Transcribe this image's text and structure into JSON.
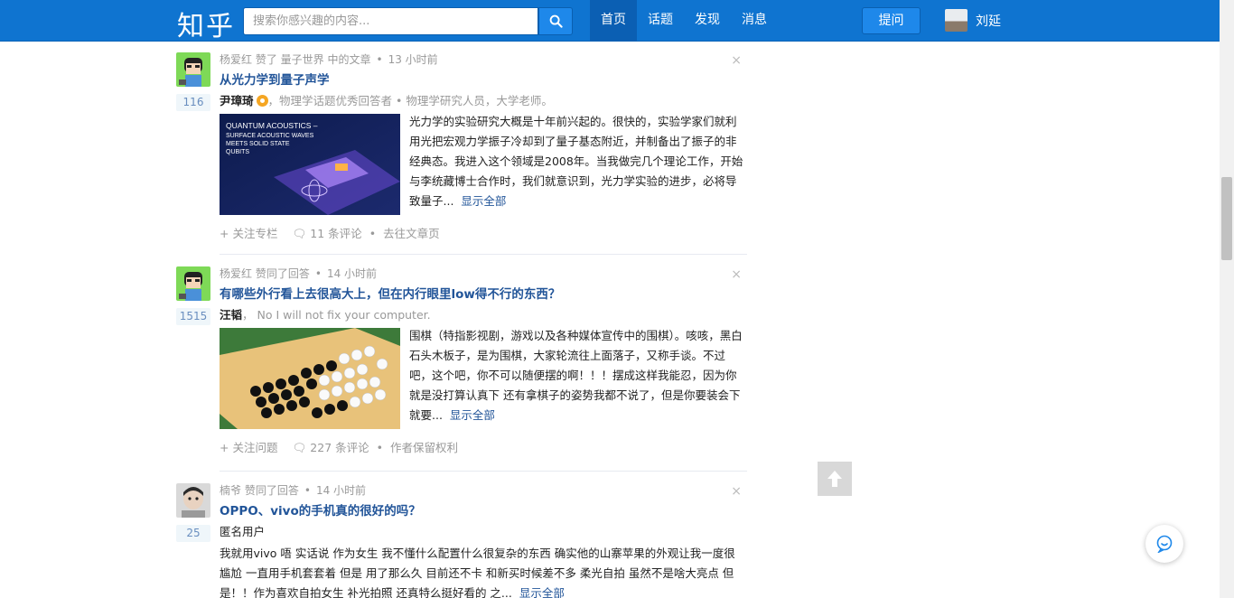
{
  "header": {
    "logo": "知乎",
    "search_placeholder": "搜索你感兴趣的内容...",
    "nav": [
      "首页",
      "话题",
      "发现",
      "消息"
    ],
    "ask_label": "提问",
    "user_name": "刘延"
  },
  "feed": [
    {
      "actor": "杨爱红",
      "action": "赞了 量子世界 中的文章",
      "time": "13 小时前",
      "votes": "116",
      "title": "从光力学到量子声学",
      "author_name": "尹璋琦",
      "author_bio": "，物理学话题优秀回答者 • 物理学研究人员，大学老师。",
      "thumb_text": [
        "QUANTUM ACOUSTICS –",
        "SURFACE ACOUSTIC WAVES",
        "MEETS SOLID STATE",
        "QUBITS"
      ],
      "summary": "光力学的实验研究大概是十年前兴起的。很快的，实验学家们就利用光把宏观力学振子冷却到了量子基态附近，并制备出了振子的非经典态。我进入这个领域是2008年。当我做完几个理论工作，开始与李统藏博士合作时，我们就意识到，光力学实验的进步，必将导致量子...",
      "more": "显示全部",
      "actions": [
        "+ 关注专栏",
        "11 条评论",
        "去往文章页"
      ]
    },
    {
      "actor": "杨爱红",
      "action": "赞同了回答",
      "time": "14 小时前",
      "votes": "1515",
      "title": "有哪些外行看上去很高大上，但在内行眼里low得不行的东西？",
      "author_name": "汪韬",
      "author_bio": "， No I will not fix your computer.",
      "summary": "围棋（特指影视剧，游戏以及各种媒体宣传中的围棋）。咳咳，黑白石头木板子，是为围棋，大家轮流往上面落子，又称手谈。不过吧，这个吧，你不可以随便摆的啊！！！摆成这样我能忍，因为你就是没打算认真下 还有拿棋子的姿势我都不说了，但是你要装会下就要...",
      "more": "显示全部",
      "actions": [
        "+ 关注问题",
        "227 条评论",
        "作者保留权利"
      ]
    },
    {
      "actor": "楠爷",
      "action": "赞同了回答",
      "time": "14 小时前",
      "votes": "25",
      "title": "OPPO、vivo的手机真的很好的吗？",
      "author_name": "匿名用户",
      "summary": "我就用vivo 唔 实话说 作为女生 我不懂什么配置什么很复杂的东西 确实他的山寨苹果的外观让我一度很尴尬 一直用手机套套着 但是 用了那么久 目前还不卡 和新买时候差不多 柔光自拍 虽然不是啥大亮点 但是！！作为喜欢自拍女生 补光拍照 还真特么挺好看的 之...",
      "more": "显示全部"
    }
  ],
  "close_symbol": "×"
}
